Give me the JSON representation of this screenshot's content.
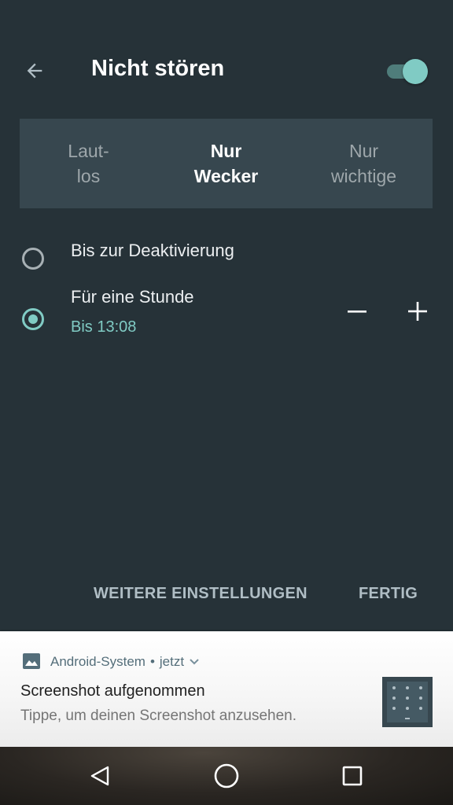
{
  "header": {
    "title": "Nicht stören",
    "back_icon": "arrow-back-icon",
    "toggle_on": true
  },
  "modes": [
    {
      "line1": "Laut-",
      "line2": "los",
      "selected": false
    },
    {
      "line1": "Nur",
      "line2": "Wecker",
      "selected": true
    },
    {
      "line1": "Nur",
      "line2": "wichtige",
      "selected": false
    }
  ],
  "options": {
    "until_off": {
      "label": "Bis zur Deaktivierung",
      "checked": false
    },
    "one_hour": {
      "label": "Für eine Stunde",
      "sub": "Bis 13:08",
      "checked": true
    }
  },
  "actions": {
    "more_settings": "WEITERE EINSTELLUNGEN",
    "done": "FERTIG"
  },
  "notification": {
    "app_icon": "image-icon",
    "app": "Android-System",
    "separator": "•",
    "time": "jetzt",
    "title": "Screenshot aufgenommen",
    "text": "Tippe, um deinen Screenshot anzusehen."
  },
  "nav": {
    "back": "back-triangle-icon",
    "home": "home-circle-icon",
    "recents": "recents-square-icon"
  },
  "colors": {
    "background": "#263238",
    "mode_bar": "#37474f",
    "accent": "#80cbc4"
  }
}
